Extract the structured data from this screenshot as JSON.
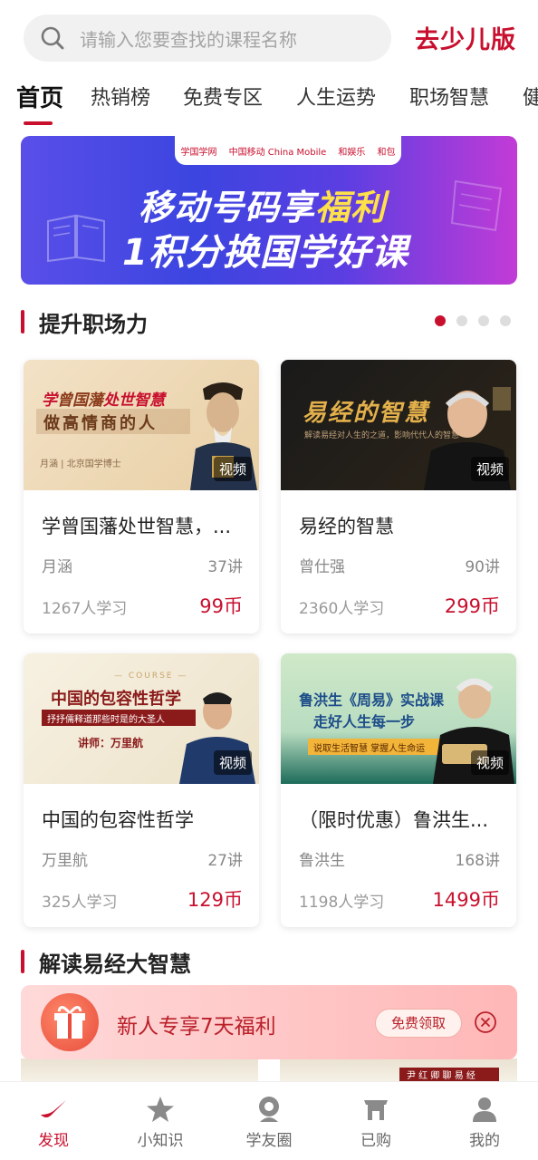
{
  "search": {
    "placeholder": "请输入您要查找的课程名称",
    "kids_link": "去少儿版"
  },
  "tabs": [
    {
      "label": "首页",
      "active": true
    },
    {
      "label": "热销榜"
    },
    {
      "label": "免费专区"
    },
    {
      "label": "人生运势"
    },
    {
      "label": "职场智慧"
    },
    {
      "label": "健"
    }
  ],
  "banner": {
    "logos": [
      "学国学网",
      "中国移动 China Mobile",
      "和娱乐",
      "和包"
    ],
    "line1_a": "移动号码享",
    "line1_b": "福利",
    "line2": "1积分换国学好课"
  },
  "section1": {
    "title": "提升职场力",
    "active_dot": 0,
    "dots": 4
  },
  "courses": [
    {
      "title": "学曾国藩处世智慧，...",
      "teacher": "月涵",
      "lessons": "37讲",
      "students": "1267人学习",
      "price": "99币",
      "tag": "视频",
      "thumb": {
        "main_a": "学",
        "main_b": "曾国藩",
        "main_c": "处世智慧",
        "sub": "做高情商的人",
        "name": "月涵 | 北京国学博士"
      }
    },
    {
      "title": "易经的智慧",
      "teacher": "曾仕强",
      "lessons": "90讲",
      "students": "2360人学习",
      "price": "299币",
      "tag": "视频",
      "thumb": {
        "main": "易经的智慧",
        "sub": "解读易经对人生的之道，影响代代人的智慧"
      }
    },
    {
      "title": "中国的包容性哲学",
      "teacher": "万里航",
      "lessons": "27讲",
      "students": "325人学习",
      "price": "129币",
      "tag": "视频",
      "thumb": {
        "course": "— COURSE —",
        "main": "中国的包容性哲学",
        "bar": "抒抒儒释道那些时是的大圣人",
        "teacher": "讲师：万里航"
      }
    },
    {
      "title": "（限时优惠）鲁洪生...",
      "teacher": "鲁洪生",
      "lessons": "168讲",
      "students": "1198人学习",
      "price": "1499币",
      "tag": "视频",
      "thumb": {
        "main": "鲁洪生《周易》实战课",
        "sub": "走好人生每一步",
        "bar": "说取生活智慧  掌握人生命运"
      }
    }
  ],
  "section2": {
    "title": "解读易经大智慧"
  },
  "promo": {
    "text": "新人专享7天福利",
    "button": "免费领取"
  },
  "peek": {
    "badge": "尹 红 卿 聊 易 经"
  },
  "bottom_nav": [
    {
      "label": "发现",
      "icon": "discover-icon",
      "active": true
    },
    {
      "label": "小知识",
      "icon": "star-icon"
    },
    {
      "label": "学友圈",
      "icon": "community-icon"
    },
    {
      "label": "已购",
      "icon": "purchased-icon"
    },
    {
      "label": "我的",
      "icon": "profile-icon"
    }
  ],
  "colors": {
    "accent": "#c8102e",
    "promo_bg": "#ffc6c6"
  }
}
